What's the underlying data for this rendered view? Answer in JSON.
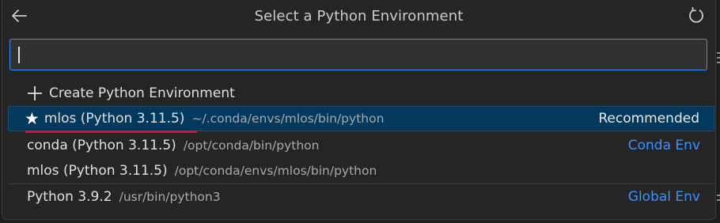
{
  "header": {
    "title": "Select a Python Environment",
    "back_icon": "arrow-left-icon",
    "refresh_icon": "refresh-icon"
  },
  "search": {
    "value": "",
    "placeholder": ""
  },
  "create_item": {
    "icon": "plus-icon",
    "label": "Create Python Environment"
  },
  "environments": [
    {
      "icon": "star-icon",
      "label": "mlos (Python 3.11.5)",
      "path": "~/.conda/envs/mlos/bin/python",
      "detail": "Recommended",
      "selected": true
    },
    {
      "label": "conda (Python 3.11.5)",
      "path": "/opt/conda/bin/python",
      "detail": "Conda Env"
    },
    {
      "label": "mlos (Python 3.11.5)",
      "path": "/opt/conda/envs/mlos/bin/python",
      "detail": ""
    },
    {
      "label": "Python 3.9.2",
      "path": "/usr/bin/python3",
      "detail": "Global Env"
    }
  ],
  "colors": {
    "panel_bg": "#252526",
    "selected_bg": "#04395e",
    "focus_border": "#3794ff",
    "link": "#3794ff",
    "annotation_red": "#e81123"
  }
}
